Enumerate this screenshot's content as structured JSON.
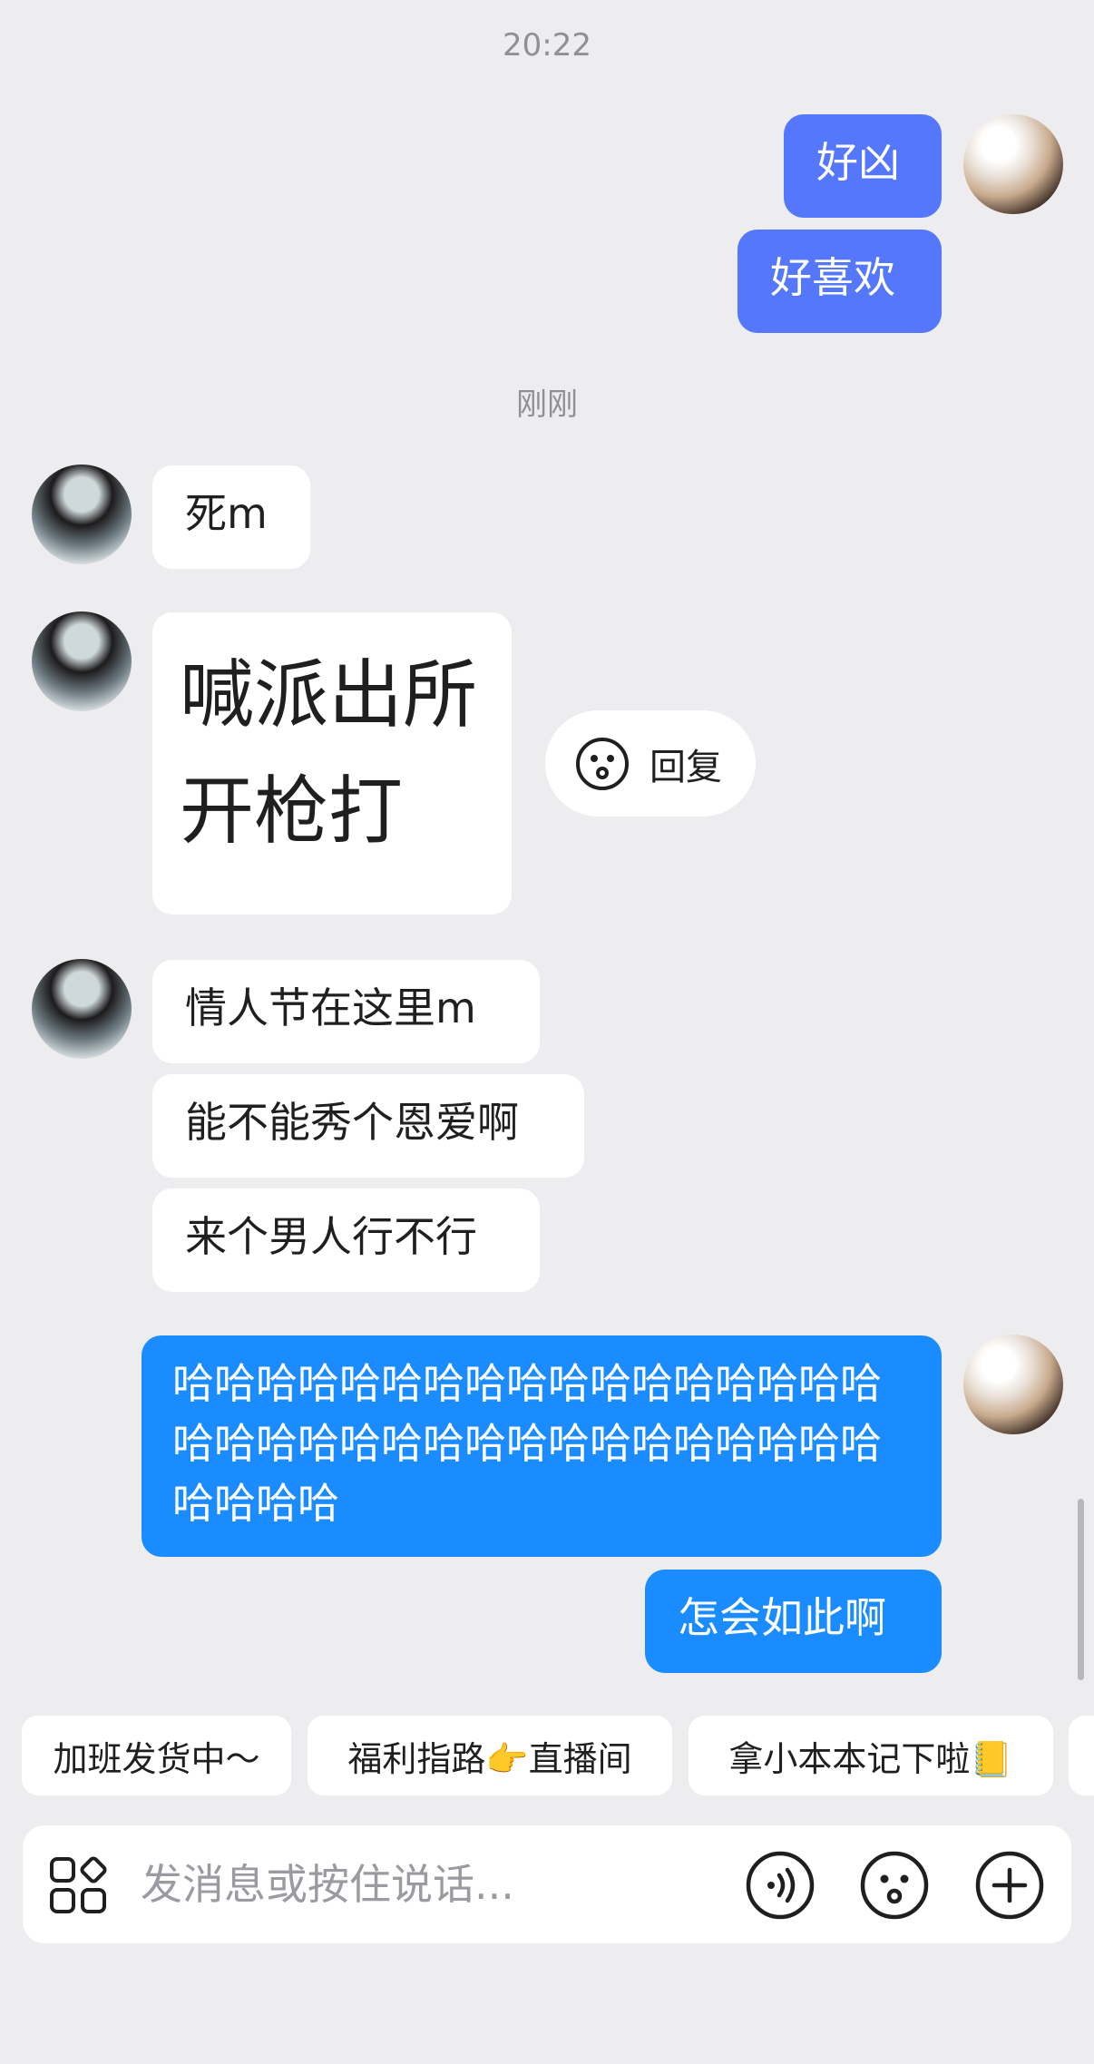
{
  "timestamps": [
    "20:22",
    "刚刚"
  ],
  "messages": {
    "m1": "好凶",
    "m2": "好喜欢",
    "m3": "死m",
    "m4": "喊派出所\n开枪打",
    "m5": "情人节在这里m",
    "m6": "能不能秀个恩爱啊",
    "m7": "来个男人行不行",
    "m8": "哈哈哈哈哈哈哈哈哈哈哈哈哈哈哈哈哈哈哈哈哈哈哈哈哈哈哈哈哈哈哈哈哈哈哈哈哈哈",
    "m9": "怎会如此啊"
  },
  "reply_label": "回复",
  "quick_replies": [
    "加班发货中～",
    "福利指路👉直播间",
    "拿小本本记下啦📒"
  ],
  "input": {
    "placeholder": "发消息或按住说话..."
  },
  "icons": {
    "reply": "smiley-icon",
    "apps": "apps-grid-icon",
    "voice": "voice-icon",
    "emoji": "emoji-icon",
    "add": "plus-icon"
  },
  "colors": {
    "background": "#ededf0",
    "self_bubble_indigo": "#5477fc",
    "self_bubble_blue": "#1a8cff",
    "other_bubble": "#ffffff"
  }
}
